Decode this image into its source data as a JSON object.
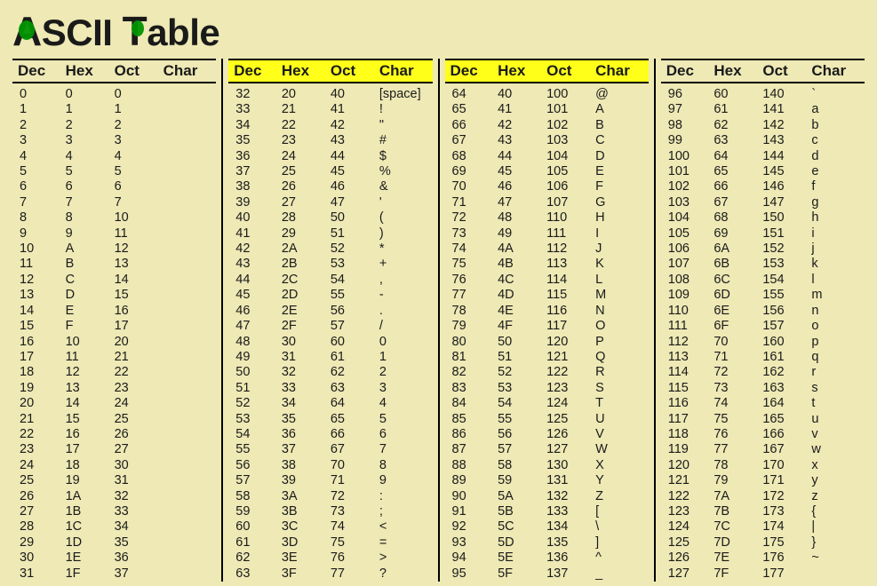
{
  "title": {
    "full": "ASCII Table",
    "word1": "ASCII",
    "word2": "Table"
  },
  "headers": {
    "dec": "Dec",
    "hex": "Hex",
    "oct": "Oct",
    "char": "Char"
  },
  "chart_data": {
    "type": "table",
    "title": "ASCII Table",
    "columns_per_block": [
      "Dec",
      "Hex",
      "Oct",
      "Char"
    ],
    "highlighted_blocks": [
      1,
      2
    ],
    "blocks": [
      [
        {
          "dec": "0",
          "hex": "0",
          "oct": "0",
          "char": ""
        },
        {
          "dec": "1",
          "hex": "1",
          "oct": "1",
          "char": ""
        },
        {
          "dec": "2",
          "hex": "2",
          "oct": "2",
          "char": ""
        },
        {
          "dec": "3",
          "hex": "3",
          "oct": "3",
          "char": ""
        },
        {
          "dec": "4",
          "hex": "4",
          "oct": "4",
          "char": ""
        },
        {
          "dec": "5",
          "hex": "5",
          "oct": "5",
          "char": ""
        },
        {
          "dec": "6",
          "hex": "6",
          "oct": "6",
          "char": ""
        },
        {
          "dec": "7",
          "hex": "7",
          "oct": "7",
          "char": ""
        },
        {
          "dec": "8",
          "hex": "8",
          "oct": "10",
          "char": ""
        },
        {
          "dec": "9",
          "hex": "9",
          "oct": "11",
          "char": ""
        },
        {
          "dec": "10",
          "hex": "A",
          "oct": "12",
          "char": ""
        },
        {
          "dec": "11",
          "hex": "B",
          "oct": "13",
          "char": ""
        },
        {
          "dec": "12",
          "hex": "C",
          "oct": "14",
          "char": ""
        },
        {
          "dec": "13",
          "hex": "D",
          "oct": "15",
          "char": ""
        },
        {
          "dec": "14",
          "hex": "E",
          "oct": "16",
          "char": ""
        },
        {
          "dec": "15",
          "hex": "F",
          "oct": "17",
          "char": ""
        },
        {
          "dec": "16",
          "hex": "10",
          "oct": "20",
          "char": ""
        },
        {
          "dec": "17",
          "hex": "11",
          "oct": "21",
          "char": ""
        },
        {
          "dec": "18",
          "hex": "12",
          "oct": "22",
          "char": ""
        },
        {
          "dec": "19",
          "hex": "13",
          "oct": "23",
          "char": ""
        },
        {
          "dec": "20",
          "hex": "14",
          "oct": "24",
          "char": ""
        },
        {
          "dec": "21",
          "hex": "15",
          "oct": "25",
          "char": ""
        },
        {
          "dec": "22",
          "hex": "16",
          "oct": "26",
          "char": ""
        },
        {
          "dec": "23",
          "hex": "17",
          "oct": "27",
          "char": ""
        },
        {
          "dec": "24",
          "hex": "18",
          "oct": "30",
          "char": ""
        },
        {
          "dec": "25",
          "hex": "19",
          "oct": "31",
          "char": ""
        },
        {
          "dec": "26",
          "hex": "1A",
          "oct": "32",
          "char": ""
        },
        {
          "dec": "27",
          "hex": "1B",
          "oct": "33",
          "char": ""
        },
        {
          "dec": "28",
          "hex": "1C",
          "oct": "34",
          "char": ""
        },
        {
          "dec": "29",
          "hex": "1D",
          "oct": "35",
          "char": ""
        },
        {
          "dec": "30",
          "hex": "1E",
          "oct": "36",
          "char": ""
        },
        {
          "dec": "31",
          "hex": "1F",
          "oct": "37",
          "char": ""
        }
      ],
      [
        {
          "dec": "32",
          "hex": "20",
          "oct": "40",
          "char": "[space]"
        },
        {
          "dec": "33",
          "hex": "21",
          "oct": "41",
          "char": "!"
        },
        {
          "dec": "34",
          "hex": "22",
          "oct": "42",
          "char": "\""
        },
        {
          "dec": "35",
          "hex": "23",
          "oct": "43",
          "char": "#"
        },
        {
          "dec": "36",
          "hex": "24",
          "oct": "44",
          "char": "$"
        },
        {
          "dec": "37",
          "hex": "25",
          "oct": "45",
          "char": "%"
        },
        {
          "dec": "38",
          "hex": "26",
          "oct": "46",
          "char": "&"
        },
        {
          "dec": "39",
          "hex": "27",
          "oct": "47",
          "char": "'"
        },
        {
          "dec": "40",
          "hex": "28",
          "oct": "50",
          "char": "("
        },
        {
          "dec": "41",
          "hex": "29",
          "oct": "51",
          "char": ")"
        },
        {
          "dec": "42",
          "hex": "2A",
          "oct": "52",
          "char": "*"
        },
        {
          "dec": "43",
          "hex": "2B",
          "oct": "53",
          "char": "+"
        },
        {
          "dec": "44",
          "hex": "2C",
          "oct": "54",
          "char": ","
        },
        {
          "dec": "45",
          "hex": "2D",
          "oct": "55",
          "char": "-"
        },
        {
          "dec": "46",
          "hex": "2E",
          "oct": "56",
          "char": "."
        },
        {
          "dec": "47",
          "hex": "2F",
          "oct": "57",
          "char": "/"
        },
        {
          "dec": "48",
          "hex": "30",
          "oct": "60",
          "char": "0"
        },
        {
          "dec": "49",
          "hex": "31",
          "oct": "61",
          "char": "1"
        },
        {
          "dec": "50",
          "hex": "32",
          "oct": "62",
          "char": "2"
        },
        {
          "dec": "51",
          "hex": "33",
          "oct": "63",
          "char": "3"
        },
        {
          "dec": "52",
          "hex": "34",
          "oct": "64",
          "char": "4"
        },
        {
          "dec": "53",
          "hex": "35",
          "oct": "65",
          "char": "5"
        },
        {
          "dec": "54",
          "hex": "36",
          "oct": "66",
          "char": "6"
        },
        {
          "dec": "55",
          "hex": "37",
          "oct": "67",
          "char": "7"
        },
        {
          "dec": "56",
          "hex": "38",
          "oct": "70",
          "char": "8"
        },
        {
          "dec": "57",
          "hex": "39",
          "oct": "71",
          "char": "9"
        },
        {
          "dec": "58",
          "hex": "3A",
          "oct": "72",
          "char": ":"
        },
        {
          "dec": "59",
          "hex": "3B",
          "oct": "73",
          "char": ";"
        },
        {
          "dec": "60",
          "hex": "3C",
          "oct": "74",
          "char": "<"
        },
        {
          "dec": "61",
          "hex": "3D",
          "oct": "75",
          "char": "="
        },
        {
          "dec": "62",
          "hex": "3E",
          "oct": "76",
          "char": ">"
        },
        {
          "dec": "63",
          "hex": "3F",
          "oct": "77",
          "char": "?"
        }
      ],
      [
        {
          "dec": "64",
          "hex": "40",
          "oct": "100",
          "char": "@"
        },
        {
          "dec": "65",
          "hex": "41",
          "oct": "101",
          "char": "A"
        },
        {
          "dec": "66",
          "hex": "42",
          "oct": "102",
          "char": "B"
        },
        {
          "dec": "67",
          "hex": "43",
          "oct": "103",
          "char": "C"
        },
        {
          "dec": "68",
          "hex": "44",
          "oct": "104",
          "char": "D"
        },
        {
          "dec": "69",
          "hex": "45",
          "oct": "105",
          "char": "E"
        },
        {
          "dec": "70",
          "hex": "46",
          "oct": "106",
          "char": "F"
        },
        {
          "dec": "71",
          "hex": "47",
          "oct": "107",
          "char": "G"
        },
        {
          "dec": "72",
          "hex": "48",
          "oct": "110",
          "char": "H"
        },
        {
          "dec": "73",
          "hex": "49",
          "oct": "111",
          "char": "I"
        },
        {
          "dec": "74",
          "hex": "4A",
          "oct": "112",
          "char": "J"
        },
        {
          "dec": "75",
          "hex": "4B",
          "oct": "113",
          "char": "K"
        },
        {
          "dec": "76",
          "hex": "4C",
          "oct": "114",
          "char": "L"
        },
        {
          "dec": "77",
          "hex": "4D",
          "oct": "115",
          "char": "M"
        },
        {
          "dec": "78",
          "hex": "4E",
          "oct": "116",
          "char": "N"
        },
        {
          "dec": "79",
          "hex": "4F",
          "oct": "117",
          "char": "O"
        },
        {
          "dec": "80",
          "hex": "50",
          "oct": "120",
          "char": "P"
        },
        {
          "dec": "81",
          "hex": "51",
          "oct": "121",
          "char": "Q"
        },
        {
          "dec": "82",
          "hex": "52",
          "oct": "122",
          "char": "R"
        },
        {
          "dec": "83",
          "hex": "53",
          "oct": "123",
          "char": "S"
        },
        {
          "dec": "84",
          "hex": "54",
          "oct": "124",
          "char": "T"
        },
        {
          "dec": "85",
          "hex": "55",
          "oct": "125",
          "char": "U"
        },
        {
          "dec": "86",
          "hex": "56",
          "oct": "126",
          "char": "V"
        },
        {
          "dec": "87",
          "hex": "57",
          "oct": "127",
          "char": "W"
        },
        {
          "dec": "88",
          "hex": "58",
          "oct": "130",
          "char": "X"
        },
        {
          "dec": "89",
          "hex": "59",
          "oct": "131",
          "char": "Y"
        },
        {
          "dec": "90",
          "hex": "5A",
          "oct": "132",
          "char": "Z"
        },
        {
          "dec": "91",
          "hex": "5B",
          "oct": "133",
          "char": "["
        },
        {
          "dec": "92",
          "hex": "5C",
          "oct": "134",
          "char": "\\"
        },
        {
          "dec": "93",
          "hex": "5D",
          "oct": "135",
          "char": "]"
        },
        {
          "dec": "94",
          "hex": "5E",
          "oct": "136",
          "char": "^"
        },
        {
          "dec": "95",
          "hex": "5F",
          "oct": "137",
          "char": "_"
        }
      ],
      [
        {
          "dec": "96",
          "hex": "60",
          "oct": "140",
          "char": "`"
        },
        {
          "dec": "97",
          "hex": "61",
          "oct": "141",
          "char": "a"
        },
        {
          "dec": "98",
          "hex": "62",
          "oct": "142",
          "char": "b"
        },
        {
          "dec": "99",
          "hex": "63",
          "oct": "143",
          "char": "c"
        },
        {
          "dec": "100",
          "hex": "64",
          "oct": "144",
          "char": "d"
        },
        {
          "dec": "101",
          "hex": "65",
          "oct": "145",
          "char": "e"
        },
        {
          "dec": "102",
          "hex": "66",
          "oct": "146",
          "char": "f"
        },
        {
          "dec": "103",
          "hex": "67",
          "oct": "147",
          "char": "g"
        },
        {
          "dec": "104",
          "hex": "68",
          "oct": "150",
          "char": "h"
        },
        {
          "dec": "105",
          "hex": "69",
          "oct": "151",
          "char": "i"
        },
        {
          "dec": "106",
          "hex": "6A",
          "oct": "152",
          "char": "j"
        },
        {
          "dec": "107",
          "hex": "6B",
          "oct": "153",
          "char": "k"
        },
        {
          "dec": "108",
          "hex": "6C",
          "oct": "154",
          "char": "l"
        },
        {
          "dec": "109",
          "hex": "6D",
          "oct": "155",
          "char": "m"
        },
        {
          "dec": "110",
          "hex": "6E",
          "oct": "156",
          "char": "n"
        },
        {
          "dec": "111",
          "hex": "6F",
          "oct": "157",
          "char": "o"
        },
        {
          "dec": "112",
          "hex": "70",
          "oct": "160",
          "char": "p"
        },
        {
          "dec": "113",
          "hex": "71",
          "oct": "161",
          "char": "q"
        },
        {
          "dec": "114",
          "hex": "72",
          "oct": "162",
          "char": "r"
        },
        {
          "dec": "115",
          "hex": "73",
          "oct": "163",
          "char": "s"
        },
        {
          "dec": "116",
          "hex": "74",
          "oct": "164",
          "char": "t"
        },
        {
          "dec": "117",
          "hex": "75",
          "oct": "165",
          "char": "u"
        },
        {
          "dec": "118",
          "hex": "76",
          "oct": "166",
          "char": "v"
        },
        {
          "dec": "119",
          "hex": "77",
          "oct": "167",
          "char": "w"
        },
        {
          "dec": "120",
          "hex": "78",
          "oct": "170",
          "char": "x"
        },
        {
          "dec": "121",
          "hex": "79",
          "oct": "171",
          "char": "y"
        },
        {
          "dec": "122",
          "hex": "7A",
          "oct": "172",
          "char": "z"
        },
        {
          "dec": "123",
          "hex": "7B",
          "oct": "173",
          "char": "{"
        },
        {
          "dec": "124",
          "hex": "7C",
          "oct": "174",
          "char": "|"
        },
        {
          "dec": "125",
          "hex": "7D",
          "oct": "175",
          "char": "}"
        },
        {
          "dec": "126",
          "hex": "7E",
          "oct": "176",
          "char": "~"
        },
        {
          "dec": "127",
          "hex": "7F",
          "oct": "177",
          "char": ""
        }
      ]
    ]
  }
}
